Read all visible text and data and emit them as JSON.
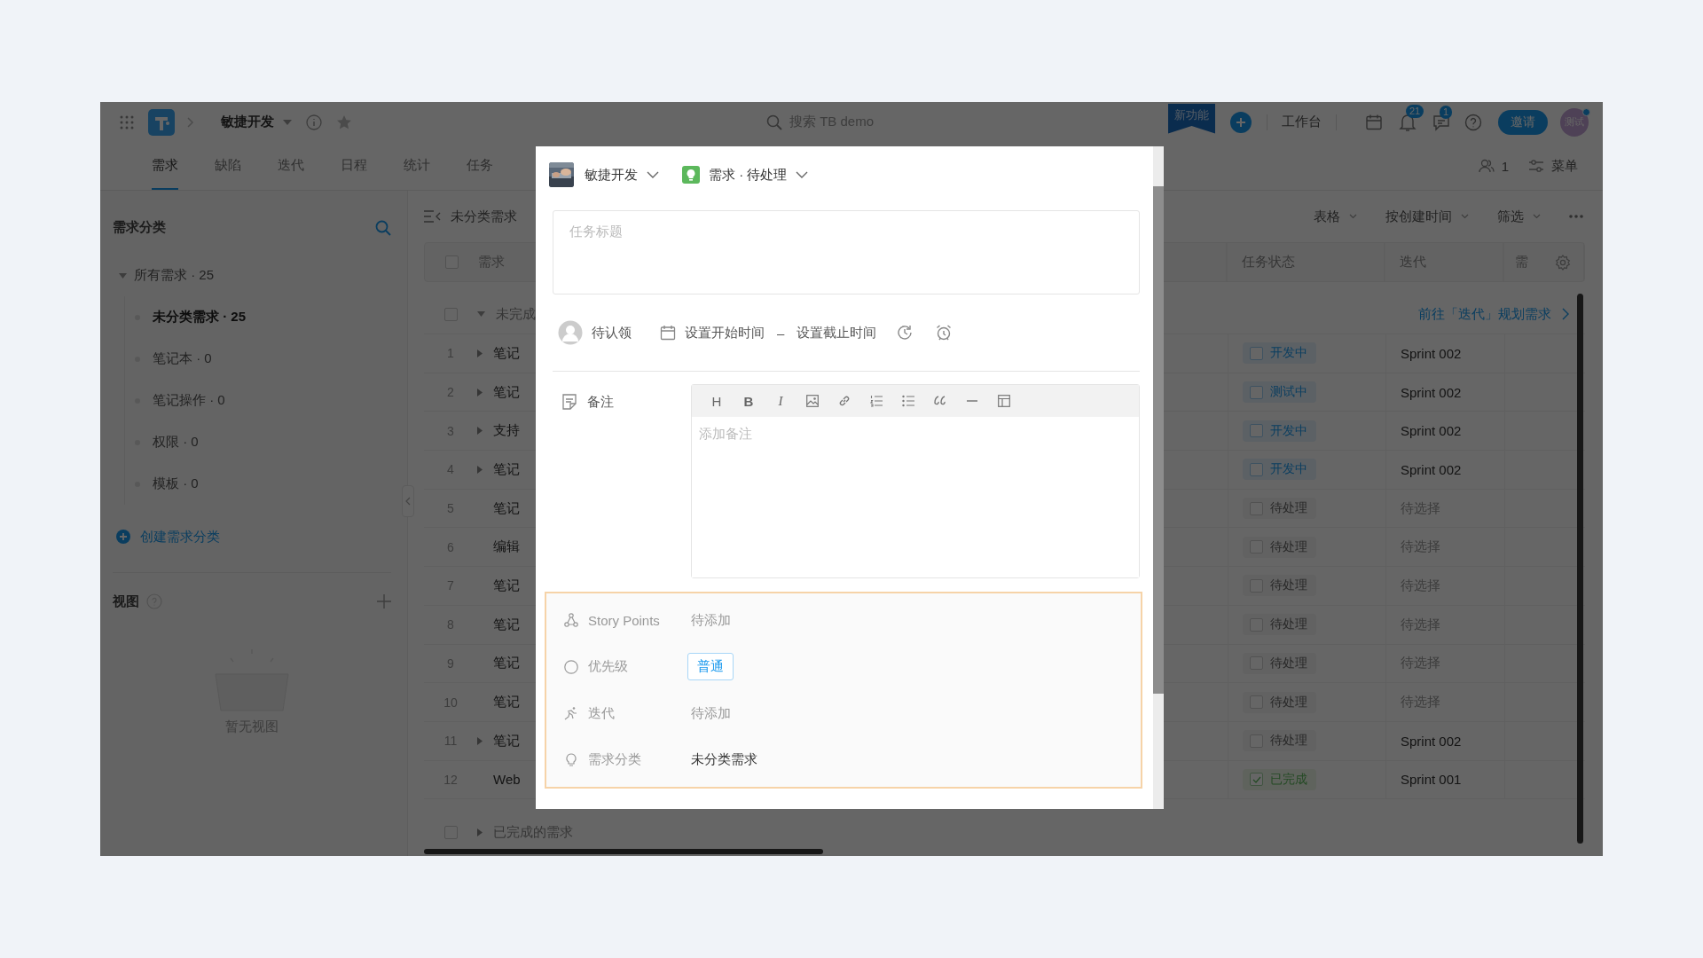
{
  "topbar": {
    "project": "敏捷开发",
    "search_placeholder": "搜索 TB demo",
    "new_feature_badge": "新功能",
    "workbench": "工作台",
    "notifications_count": "21",
    "messages_count": "1",
    "invite": "邀请",
    "avatar": "测试"
  },
  "tabs": [
    {
      "label": "需求",
      "selected": true
    },
    {
      "label": "缺陷",
      "selected": false
    },
    {
      "label": "迭代",
      "selected": false
    },
    {
      "label": "日程",
      "selected": false
    },
    {
      "label": "统计",
      "selected": false
    },
    {
      "label": "任务",
      "selected": false
    }
  ],
  "members_count": "1",
  "menu": "菜单",
  "sidebar": {
    "title": "需求分类",
    "tree": [
      {
        "label": "所有需求 · 25",
        "expanded": true,
        "children": [
          {
            "label": "未分类需求 · 25",
            "selected": true
          },
          {
            "label": "笔记本 · 0",
            "selected": false
          },
          {
            "label": "笔记操作 · 0",
            "selected": false
          },
          {
            "label": "权限 · 0",
            "selected": false
          },
          {
            "label": "模板 · 0",
            "selected": false
          }
        ]
      }
    ],
    "create_link": "创建需求分类",
    "views_title": "视图",
    "views_empty": "暂无视图"
  },
  "table": {
    "breadcrumb": "未分类需求",
    "view_options": [
      "表格",
      "按创建时间",
      "筛选"
    ],
    "select_all_checked": false,
    "columns": [
      "需求",
      "任务状态",
      "迭代",
      "需"
    ],
    "group": {
      "label": "未完成",
      "expanded": true,
      "checked": false,
      "link": "前往「迭代」规划需求"
    },
    "rows": [
      {
        "index": "1",
        "title": "笔记",
        "expandable": true,
        "status": {
          "label": "开发中",
          "kind": "active",
          "checked": false
        },
        "iteration": "Sprint 002",
        "iteration_set": true
      },
      {
        "index": "2",
        "title": "笔记",
        "expandable": true,
        "status": {
          "label": "测试中",
          "kind": "active",
          "checked": false
        },
        "iteration": "Sprint 002",
        "iteration_set": true
      },
      {
        "index": "3",
        "title": "支持",
        "expandable": true,
        "status": {
          "label": "开发中",
          "kind": "active",
          "checked": false
        },
        "iteration": "Sprint 002",
        "iteration_set": true
      },
      {
        "index": "4",
        "title": "笔记",
        "expandable": true,
        "status": {
          "label": "开发中",
          "kind": "active",
          "checked": false
        },
        "iteration": "Sprint 002",
        "iteration_set": true
      },
      {
        "index": "5",
        "title": "笔记",
        "expandable": false,
        "status": {
          "label": "待处理",
          "kind": "pending",
          "checked": false
        },
        "iteration": "待选择",
        "iteration_set": false
      },
      {
        "index": "6",
        "title": "编辑",
        "expandable": false,
        "status": {
          "label": "待处理",
          "kind": "pending",
          "checked": false
        },
        "iteration": "待选择",
        "iteration_set": false
      },
      {
        "index": "7",
        "title": "笔记",
        "expandable": false,
        "status": {
          "label": "待处理",
          "kind": "pending",
          "checked": false
        },
        "iteration": "待选择",
        "iteration_set": false
      },
      {
        "index": "8",
        "title": "笔记",
        "expandable": false,
        "status": {
          "label": "待处理",
          "kind": "pending",
          "checked": false
        },
        "iteration": "待选择",
        "iteration_set": false
      },
      {
        "index": "9",
        "title": "笔记",
        "expandable": false,
        "status": {
          "label": "待处理",
          "kind": "pending",
          "checked": false
        },
        "iteration": "待选择",
        "iteration_set": false
      },
      {
        "index": "10",
        "title": "笔记",
        "expandable": false,
        "status": {
          "label": "待处理",
          "kind": "pending",
          "checked": false
        },
        "iteration": "待选择",
        "iteration_set": false
      },
      {
        "index": "11",
        "title": "笔记",
        "expandable": true,
        "status": {
          "label": "待处理",
          "kind": "pending",
          "checked": false
        },
        "iteration": "Sprint 002",
        "iteration_set": true
      },
      {
        "index": "12",
        "title": "Web",
        "expandable": false,
        "status": {
          "label": "已完成",
          "kind": "done",
          "checked": true
        },
        "iteration": "Sprint 001",
        "iteration_set": true
      }
    ],
    "done_group": {
      "label": "已完成的需求",
      "expanded": false,
      "checked": false
    }
  },
  "modal": {
    "project": "敏捷开发",
    "type": "需求 · 待处理",
    "title_placeholder": "任务标题",
    "assignee": "待认领",
    "start_time": "设置开始时间",
    "separator": "–",
    "due_time": "设置截止时间",
    "note_label": "备注",
    "note_placeholder": "添加备注",
    "toolbar_text": [
      {
        "label": "H",
        "kind": "heading"
      },
      {
        "label": "B",
        "kind": "bold"
      },
      {
        "label": "I",
        "kind": "italic"
      }
    ],
    "fields": [
      {
        "kind": "story_points",
        "label": "Story Points",
        "placeholder": "待添加"
      },
      {
        "kind": "priority",
        "label": "优先级",
        "value": "普通"
      },
      {
        "kind": "iteration",
        "label": "迭代",
        "placeholder": "待添加"
      },
      {
        "kind": "category",
        "label": "需求分类",
        "value": "未分类需求"
      }
    ]
  }
}
